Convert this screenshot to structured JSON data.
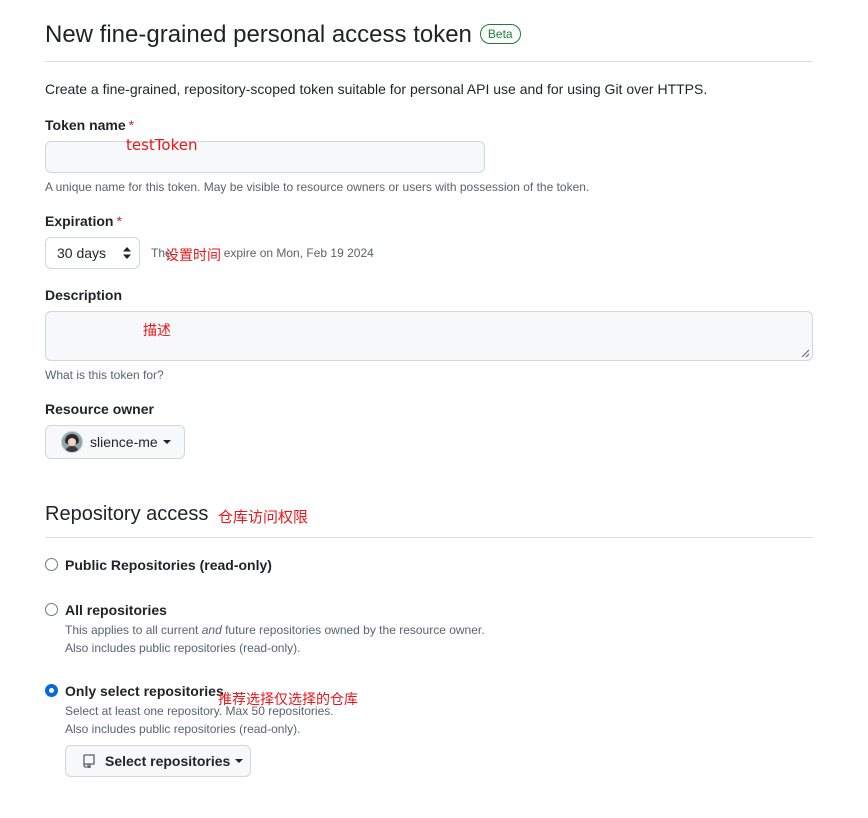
{
  "header": {
    "title": "New fine-grained personal access token",
    "badge": "Beta"
  },
  "intro": "Create a fine-grained, repository-scoped token suitable for personal API use and for using Git over HTTPS.",
  "token_name": {
    "label": "Token name",
    "required_mark": "*",
    "value": "",
    "annotation": "testToken",
    "note": "A unique name for this token. May be visible to resource owners or users with possession of the token."
  },
  "expiration": {
    "label": "Expiration",
    "required_mark": "*",
    "selected": "30 days",
    "info_prefix": "The",
    "info_suffix": "expire on Mon, Feb 19 2024",
    "annotation": "设置时间"
  },
  "description": {
    "label": "Description",
    "value": "",
    "annotation": "描述",
    "note": "What is this token for?"
  },
  "resource_owner": {
    "label": "Resource owner",
    "selected": "slience-me"
  },
  "repository_access": {
    "title": "Repository access",
    "annotation": "仓库访问权限",
    "options": [
      {
        "label": "Public Repositories (read-only)",
        "checked": false
      },
      {
        "label": "All repositories",
        "checked": false,
        "desc_before": "This applies to all current ",
        "desc_em": "and",
        "desc_after": " future repositories owned by the resource owner.",
        "desc_line2": "Also includes public repositories (read-only)."
      },
      {
        "label": "Only select repositories",
        "checked": true,
        "annotation": "推荐选择仅选择的仓库",
        "desc_line1": "Select at least one repository. Max 50 repositories.",
        "desc_line2": "Also includes public repositories (read-only)."
      }
    ],
    "select_button": "Select repositories"
  }
}
